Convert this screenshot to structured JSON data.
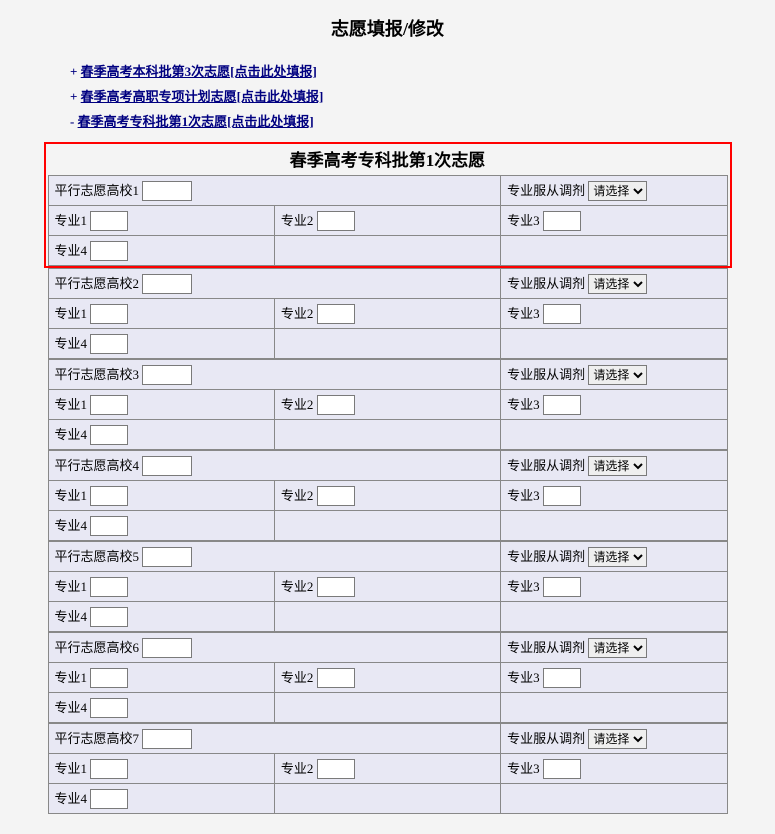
{
  "title": "志愿填报/修改",
  "links": [
    {
      "prefix": "+",
      "text": "春季高考本科批第3次志愿[点击此处填报]"
    },
    {
      "prefix": "+",
      "text": "春季高考高职专项计划志愿[点击此处填报]"
    },
    {
      "prefix": "-",
      "text": "春季高考专科批第1次志愿[点击此处填报]"
    }
  ],
  "section_title": "春季高考专科批第1次志愿",
  "labels": {
    "school_prefix": "平行志愿高校",
    "adjust_label": "专业服从调剂",
    "adjust_option": "请选择",
    "major1": "专业1",
    "major2": "专业2",
    "major3": "专业3",
    "major4": "专业4"
  },
  "schools": [
    {
      "n": "1",
      "highlighted": true
    },
    {
      "n": "2",
      "highlighted": false
    },
    {
      "n": "3",
      "highlighted": false
    },
    {
      "n": "4",
      "highlighted": false
    },
    {
      "n": "5",
      "highlighted": false
    },
    {
      "n": "6",
      "highlighted": false
    },
    {
      "n": "7",
      "highlighted": false
    }
  ]
}
